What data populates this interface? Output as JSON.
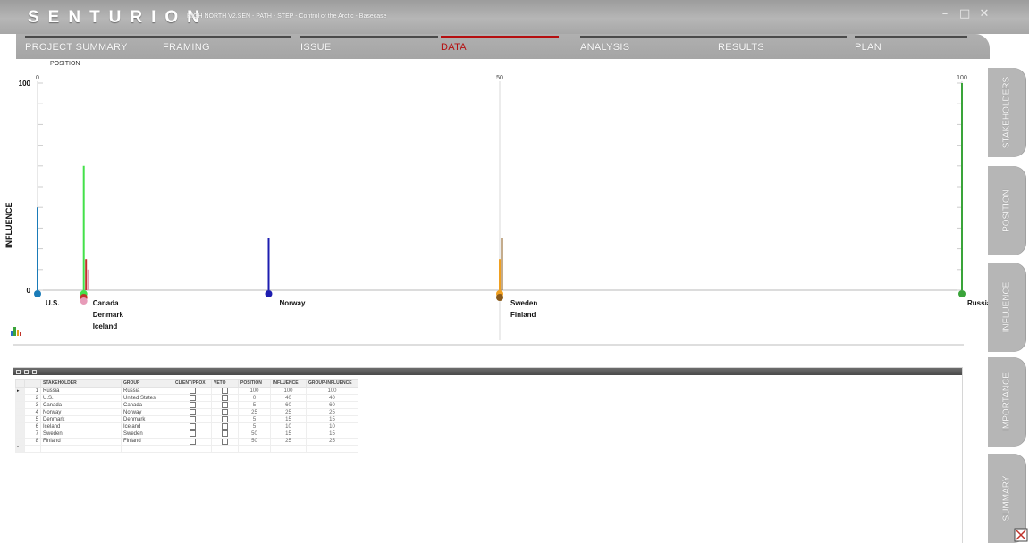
{
  "app": {
    "brand": "SENTURION",
    "document_title": "HIGH NORTH V2.SEN - PATH - STEP - Control of the Arctic - Basecase"
  },
  "window_controls": {
    "minimize": "–",
    "maximize": "□",
    "close": "✕"
  },
  "tabs": [
    {
      "label": "PROJECT SUMMARY",
      "active": false
    },
    {
      "label": "FRAMING",
      "active": false
    },
    {
      "label": "ISSUE",
      "active": false
    },
    {
      "label": "DATA",
      "active": true
    },
    {
      "label": "ANALYSIS",
      "active": false
    },
    {
      "label": "RESULTS",
      "active": false
    },
    {
      "label": "PLAN",
      "active": false
    }
  ],
  "side_tabs": [
    {
      "label": "STAKEHOLDERS"
    },
    {
      "label": "POSITION"
    },
    {
      "label": "INFLUENCE"
    },
    {
      "label": "IMPORTANCE"
    },
    {
      "label": "SUMMARY"
    }
  ],
  "chart_data": {
    "type": "bar",
    "xlabel": "POSITION",
    "ylabel": "INFLUENCE",
    "x_ticks": [
      "0",
      "50",
      "100"
    ],
    "y_ticks": [
      "100",
      "0"
    ],
    "xlim": [
      0,
      100
    ],
    "ylim": [
      0,
      100
    ],
    "grid": "vertical line at 50",
    "stakeholders": [
      {
        "name": "Russia",
        "position": 100,
        "influence": 100,
        "color": "#3aa43a"
      },
      {
        "name": "U.S.",
        "position": 0,
        "influence": 40,
        "color": "#1a7bb8"
      },
      {
        "name": "Canada",
        "position": 5,
        "influence": 60,
        "color": "#44e04a"
      },
      {
        "name": "Norway",
        "position": 25,
        "influence": 25,
        "color": "#1e1eb0"
      },
      {
        "name": "Denmark",
        "position": 5,
        "influence": 15,
        "color": "#c0322a"
      },
      {
        "name": "Iceland",
        "position": 5,
        "influence": 10,
        "color": "#e79bb8"
      },
      {
        "name": "Sweden",
        "position": 50,
        "influence": 15,
        "color": "#f0a020"
      },
      {
        "name": "Finland",
        "position": 50,
        "influence": 25,
        "color": "#8a5a1a"
      }
    ],
    "marker_labels": [
      {
        "text": "U.S.",
        "position": 0
      },
      {
        "text": "Canada",
        "position": 5
      },
      {
        "text": "Denmark",
        "position": 5
      },
      {
        "text": "Iceland",
        "position": 5
      },
      {
        "text": "Norway",
        "position": 25
      },
      {
        "text": "Sweden",
        "position": 50
      },
      {
        "text": "Finland",
        "position": 50
      },
      {
        "text": "Russia",
        "position": 100
      }
    ]
  },
  "grid": {
    "columns": [
      "STAKEHOLDER",
      "GROUP",
      "CLIENT/PROX",
      "VETO",
      "POSITION",
      "INFLUENCE",
      "GROUP-INFLUENCE"
    ],
    "rows": [
      {
        "index": "1",
        "stakeholder": "Russia",
        "group": "Russia",
        "client": false,
        "veto": false,
        "position": "100",
        "influence": "100",
        "group_influence": "100"
      },
      {
        "index": "2",
        "stakeholder": "U.S.",
        "group": "United States",
        "client": false,
        "veto": false,
        "position": "0",
        "influence": "40",
        "group_influence": "40"
      },
      {
        "index": "3",
        "stakeholder": "Canada",
        "group": "Canada",
        "client": false,
        "veto": false,
        "position": "5",
        "influence": "60",
        "group_influence": "60"
      },
      {
        "index": "4",
        "stakeholder": "Norway",
        "group": "Norway",
        "client": false,
        "veto": false,
        "position": "25",
        "influence": "25",
        "group_influence": "25"
      },
      {
        "index": "5",
        "stakeholder": "Denmark",
        "group": "Denmark",
        "client": false,
        "veto": false,
        "position": "5",
        "influence": "15",
        "group_influence": "15"
      },
      {
        "index": "6",
        "stakeholder": "Iceland",
        "group": "Iceland",
        "client": false,
        "veto": false,
        "position": "5",
        "influence": "10",
        "group_influence": "10"
      },
      {
        "index": "7",
        "stakeholder": "Sweden",
        "group": "Sweden",
        "client": false,
        "veto": false,
        "position": "50",
        "influence": "15",
        "group_influence": "15"
      },
      {
        "index": "8",
        "stakeholder": "Finland",
        "group": "Finland",
        "client": false,
        "veto": false,
        "position": "50",
        "influence": "25",
        "group_influence": "25"
      }
    ],
    "new_row_marker": "*",
    "current_row_marker": "▸"
  }
}
